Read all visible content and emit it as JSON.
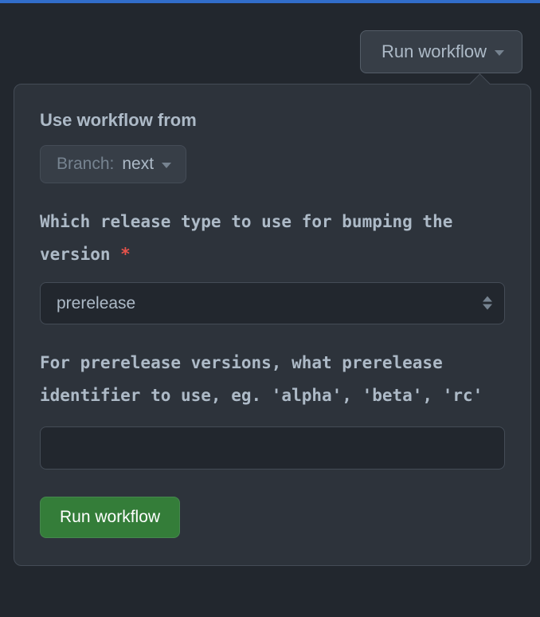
{
  "trigger": {
    "label": "Run workflow"
  },
  "form": {
    "useFromLabel": "Use workflow from",
    "branch": {
      "prefix": "Branch:",
      "name": "next"
    },
    "releaseType": {
      "label": "Which release type to use for bumping the version",
      "requiredMark": "*",
      "value": "prerelease"
    },
    "prereleaseId": {
      "label": "For prerelease versions, what prerelease identifier to use, eg. 'alpha', 'beta', 'rc'",
      "value": ""
    },
    "submitLabel": "Run workflow"
  }
}
